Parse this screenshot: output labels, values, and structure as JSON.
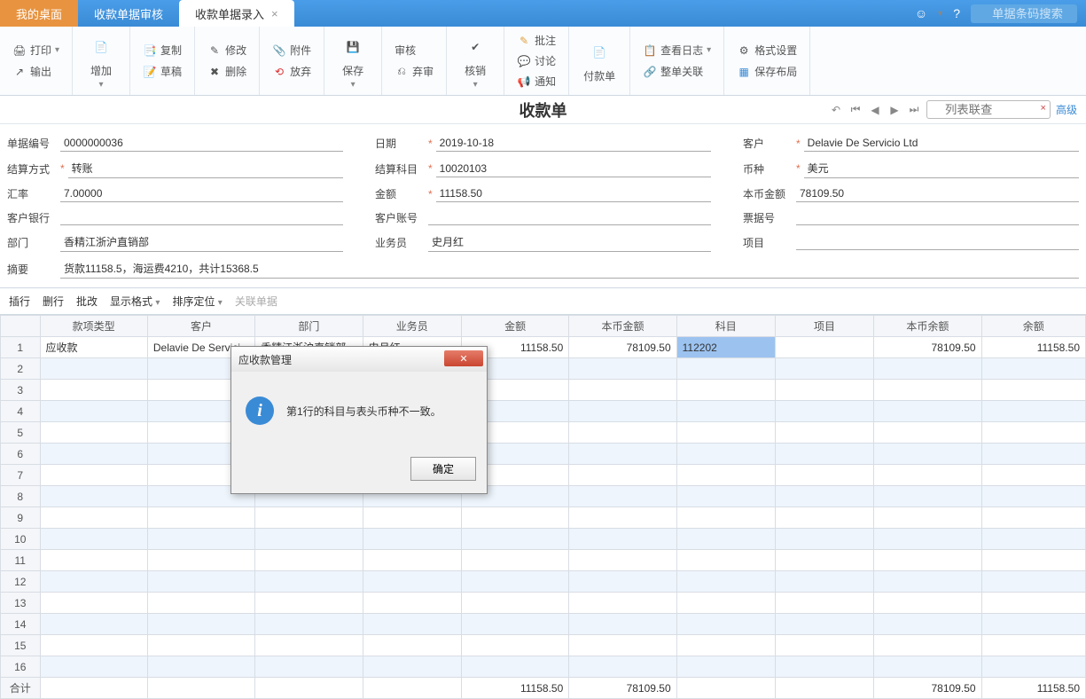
{
  "tabs": {
    "home": "我的桌面",
    "audit": "收款单据审核",
    "entry": "收款单据录入"
  },
  "top_search_placeholder": "单据条码搜索",
  "toolbar": {
    "print": "打印",
    "output": "输出",
    "add": "增加",
    "copy": "复制",
    "draft": "草稿",
    "modify": "修改",
    "delete": "删除",
    "attachment": "附件",
    "abandon": "放弃",
    "save": "保存",
    "audit": "审核",
    "discard": "弃审",
    "verify": "核销",
    "batch_note": "批注",
    "discuss": "讨论",
    "notify": "通知",
    "payment": "付款单",
    "view_log": "查看日志",
    "link": "整单关联",
    "format": "格式设置",
    "save_layout": "保存布局"
  },
  "doc": {
    "title": "收款单",
    "list_search_placeholder": "列表联查",
    "advanced": "高级"
  },
  "fields": {
    "doc_no_label": "单据编号",
    "doc_no": "0000000036",
    "settle_label": "结算方式",
    "settle": "转账",
    "rate_label": "汇率",
    "rate": "7.00000",
    "bank_label": "客户银行",
    "dept_label": "部门",
    "dept": "香精江浙沪直销部",
    "summary_label": "摘要",
    "summary": "货款11158.5，海运费4210，共计15368.5",
    "date_label": "日期",
    "date": "2019-10-18",
    "subject_label": "结算科目",
    "subject": "10020103",
    "amount_label": "金额",
    "amount": "11158.50",
    "cust_acct_label": "客户账号",
    "salesman_label": "业务员",
    "salesman": "史月红",
    "customer_label": "客户",
    "customer": "Delavie De Servicio Ltd",
    "currency_label": "币种",
    "currency": "美元",
    "local_amt_label": "本币金额",
    "local_amt": "78109.50",
    "bill_no_label": "票据号",
    "project_label": "项目"
  },
  "actions": {
    "insert": "插行",
    "delete": "删行",
    "batch": "批改",
    "display": "显示格式",
    "sort": "排序定位",
    "related": "关联单据"
  },
  "columns": {
    "type": "款项类型",
    "customer": "客户",
    "dept": "部门",
    "salesman": "业务员",
    "amount": "金额",
    "local_amount": "本币金额",
    "subject": "科目",
    "project": "项目",
    "local_balance": "本币余额",
    "balance": "余额"
  },
  "row1": {
    "type": "应收款",
    "customer": "Delavie De Servici...",
    "dept": "香精江浙沪直销部",
    "salesman": "史月红",
    "amount": "11158.50",
    "local_amount": "78109.50",
    "subject": "112202",
    "local_balance": "78109.50",
    "balance": "11158.50"
  },
  "total": {
    "label": "合计",
    "amount": "11158.50",
    "local_amount": "78109.50",
    "local_balance": "78109.50",
    "balance": "11158.50"
  },
  "dialog": {
    "title": "应收款管理",
    "message": "第1行的科目与表头币种不一致。",
    "ok": "确定"
  }
}
